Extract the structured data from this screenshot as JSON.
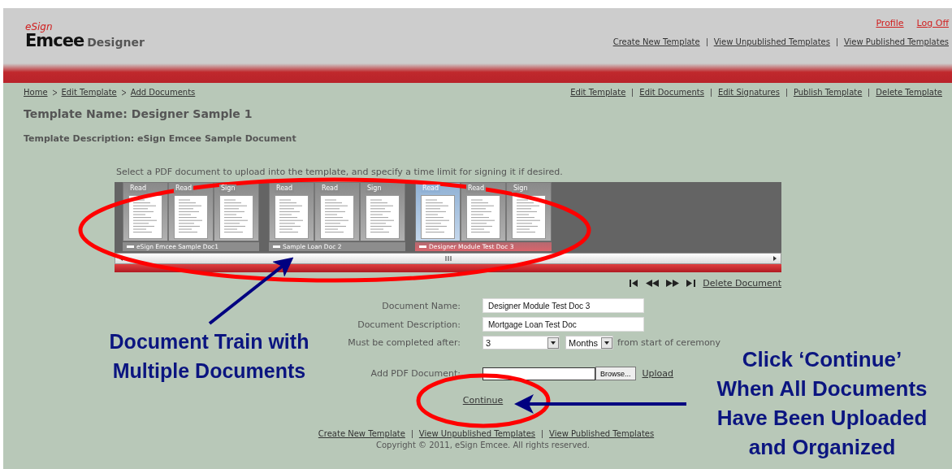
{
  "header": {
    "logo": {
      "brand_small": "eSign",
      "brand_main": "Emcee",
      "product": "Designer"
    },
    "user_links": [
      "Profile",
      "Log Off"
    ],
    "nav_links": [
      "Create New Template",
      "View Unpublished Templates",
      "View Published Templates"
    ]
  },
  "breadcrumb": [
    "Home",
    "Edit Template",
    "Add Documents"
  ],
  "actions": [
    "Edit Template",
    "Edit Documents",
    "Edit Signatures",
    "Publish Template",
    "Delete Template"
  ],
  "template_name": "Template Name: Designer Sample 1",
  "template_description": "Template Description: eSign Emcee Sample Document",
  "instruction": "Select a PDF document to upload into the template, and specify a time limit for signing it if desired.",
  "document_train": {
    "documents": [
      {
        "name": "eSign Emcee Sample Doc1",
        "selected": false,
        "pages": [
          {
            "label": "Read",
            "selected": false
          },
          {
            "label": "Read",
            "selected": false
          },
          {
            "label": "Sign",
            "selected": false
          }
        ]
      },
      {
        "name": "Sample Loan Doc 2",
        "selected": false,
        "pages": [
          {
            "label": "Read",
            "selected": false
          },
          {
            "label": "Read",
            "selected": false
          },
          {
            "label": "Sign",
            "selected": false
          }
        ]
      },
      {
        "name": "Designer Module Test Doc 3",
        "selected": true,
        "pages": [
          {
            "label": "Read",
            "selected": true
          },
          {
            "label": "Read",
            "selected": false
          },
          {
            "label": "Sign",
            "selected": false
          }
        ]
      }
    ],
    "delete_link": "Delete Document"
  },
  "form": {
    "document_name": {
      "label": "Document Name:",
      "value": "Designer Module Test Doc 3"
    },
    "document_description": {
      "label": "Document Description:",
      "value": "Mortgage Loan Test Doc"
    },
    "completion": {
      "label": "Must be completed after:",
      "count": "3",
      "unit": "Months",
      "suffix": "from start of ceremony"
    },
    "add_pdf": {
      "label": "Add PDF Document:",
      "browse": "Browse...",
      "upload": "Upload"
    }
  },
  "continue_link": "Continue",
  "footer": {
    "links": [
      "Create New Template",
      "View Unpublished Templates",
      "View Published Templates"
    ],
    "copyright": "Copyright © 2011, eSign Emcee. All rights reserved."
  },
  "annotations": {
    "callouts": [
      "Document Train with Multiple Documents",
      "Click ‘Continue’ When All Documents Have Been Uploaded and Organized"
    ]
  }
}
